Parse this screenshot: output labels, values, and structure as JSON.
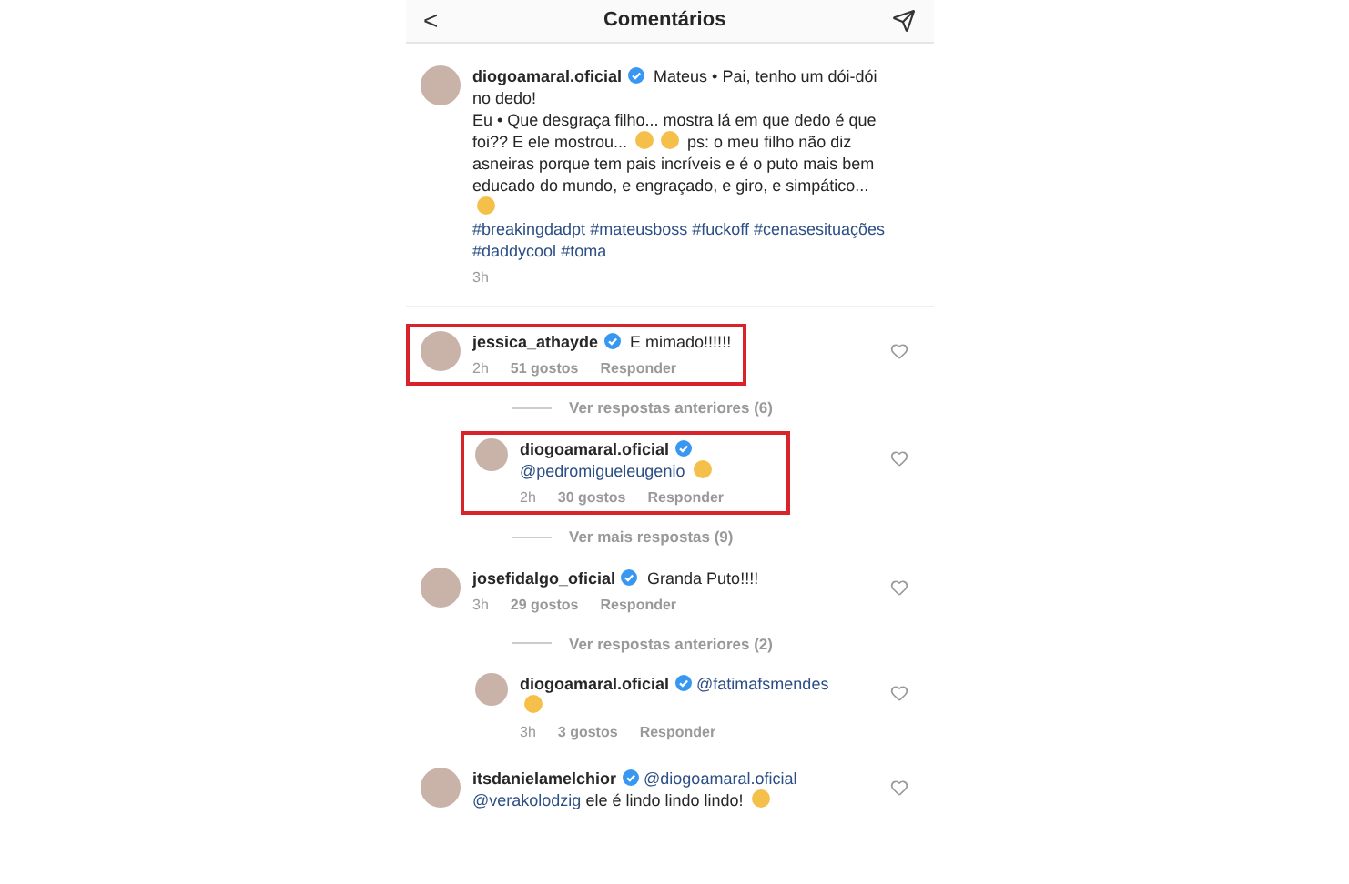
{
  "header": {
    "back": "<",
    "title": "Comentários"
  },
  "items": [
    {
      "kind": "caption",
      "user": "diogoamaral.oficial",
      "verified": true,
      "highlighted": false,
      "body": [
        {
          "kind": "text",
          "text": "Mateus • Pai, tenho um dói-dói no dedo!"
        },
        {
          "kind": "break"
        },
        {
          "kind": "text",
          "text": "Eu • Que desgraça filho... mostra lá em que dedo é que foi?? E ele mostrou..."
        },
        {
          "kind": "emoji"
        },
        {
          "kind": "emoji"
        },
        {
          "kind": "text",
          "text": "ps: o meu filho não diz asneiras porque tem pais incríveis e é o puto mais bem educado do mundo, e engraçado, e giro, e simpático..."
        },
        {
          "kind": "emoji"
        },
        {
          "kind": "break"
        },
        {
          "kind": "link",
          "text": "#breakingdadpt"
        },
        {
          "kind": "link",
          "text": "#mateusboss"
        },
        {
          "kind": "link",
          "text": "#fuckoff"
        },
        {
          "kind": "link",
          "text": "#cenasesituações"
        },
        {
          "kind": "link",
          "text": "#daddycool"
        },
        {
          "kind": "link",
          "text": "#toma"
        }
      ],
      "time": "3h"
    },
    {
      "kind": "comment",
      "user": "jessica_athayde",
      "verified": true,
      "highlighted": true,
      "body": [
        {
          "kind": "text",
          "text": "E mimado!!!!!!"
        }
      ],
      "time": "2h",
      "likes": "51 gostos",
      "reply": "Responder"
    },
    {
      "kind": "view_replies",
      "text": "Ver respostas anteriores (6)"
    },
    {
      "kind": "reply",
      "user": "diogoamaral.oficial",
      "verified": true,
      "highlighted": true,
      "body": [
        {
          "kind": "break"
        },
        {
          "kind": "link",
          "text": "@pedromigueleugenio"
        },
        {
          "kind": "emoji"
        }
      ],
      "time": "2h",
      "likes": "30 gostos",
      "reply": "Responder"
    },
    {
      "kind": "view_replies",
      "text": "Ver mais respostas (9)"
    },
    {
      "kind": "comment",
      "user": "josefidalgo_oficial",
      "verified": true,
      "highlighted": false,
      "body": [
        {
          "kind": "text",
          "text": "Granda Puto!!!!"
        }
      ],
      "time": "3h",
      "likes": "29 gostos",
      "reply": "Responder"
    },
    {
      "kind": "view_replies",
      "text": "Ver respostas anteriores (2)"
    },
    {
      "kind": "reply",
      "user": "diogoamaral.oficial",
      "verified": true,
      "highlighted": false,
      "body": [
        {
          "kind": "link",
          "text": "@fatimafsmendes"
        },
        {
          "kind": "break"
        },
        {
          "kind": "emoji"
        }
      ],
      "time": "3h",
      "likes": "3 gostos",
      "reply": "Responder"
    },
    {
      "kind": "comment",
      "user": "itsdanielamelchior",
      "verified": true,
      "highlighted": false,
      "body": [
        {
          "kind": "link",
          "text": "@diogoamaral.oficial"
        },
        {
          "kind": "break"
        },
        {
          "kind": "link",
          "text": "@verakolodzig"
        },
        {
          "kind": "text",
          "text": "ele é lindo lindo lindo!"
        },
        {
          "kind": "emoji"
        }
      ]
    }
  ]
}
